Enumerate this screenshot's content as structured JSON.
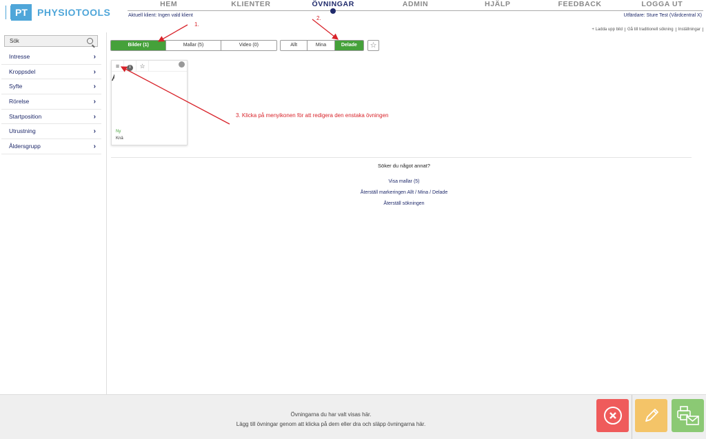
{
  "brand": {
    "mark": "PT",
    "name": "PHYSIOTOOLS"
  },
  "nav": {
    "items": [
      "HEM",
      "KLIENTER",
      "ÖVNINGAR",
      "ADMIN",
      "HJÄLP",
      "FEEDBACK",
      "LOGGA UT"
    ],
    "active": "ÖVNINGAR"
  },
  "header": {
    "client": "Aktuell klient: Ingen vald klient",
    "issuer": "Utfärdare: Sture Test (Vårdcentral X)",
    "links": [
      "+ Ladda upp bild",
      "Gå till traditionell sökning",
      "Inställningar"
    ]
  },
  "sidebar": {
    "search_placeholder": "Sök",
    "filters": [
      "Intresse",
      "Kroppsdel",
      "Syfte",
      "Rörelse",
      "Startposition",
      "Utrustning",
      "Åldersgrupp"
    ]
  },
  "tabs": {
    "type": [
      "Bilder (1)",
      "Mallar (5)",
      "Video (0)"
    ],
    "owner": [
      "Allt",
      "Mina",
      "Delade"
    ]
  },
  "card": {
    "badge": "Ny",
    "title": "Knä",
    "colors": {
      "green": "#45a13a",
      "orange": "#f0a030"
    }
  },
  "other": {
    "question": "Söker du något annat?",
    "links": [
      "Visa mallar (5)",
      "Återställ markeringen Allt / Mina / Delade",
      "Återställ sökningen"
    ]
  },
  "annotations": {
    "a1": "1.",
    "a2": "2.",
    "a3": "3. Klicka på menyikonen för att redigera den enstaka övningen"
  },
  "footer": {
    "line1": "Övningarna du har valt visas här.",
    "line2": "Lägg till övningar genom att klicka på dem eller dra och släpp övningarna här."
  },
  "colors": {
    "accent": "#45a13a",
    "brand": "#4fa6d9",
    "nav_active": "#1f2a6b",
    "annotation": "#d8232a"
  }
}
